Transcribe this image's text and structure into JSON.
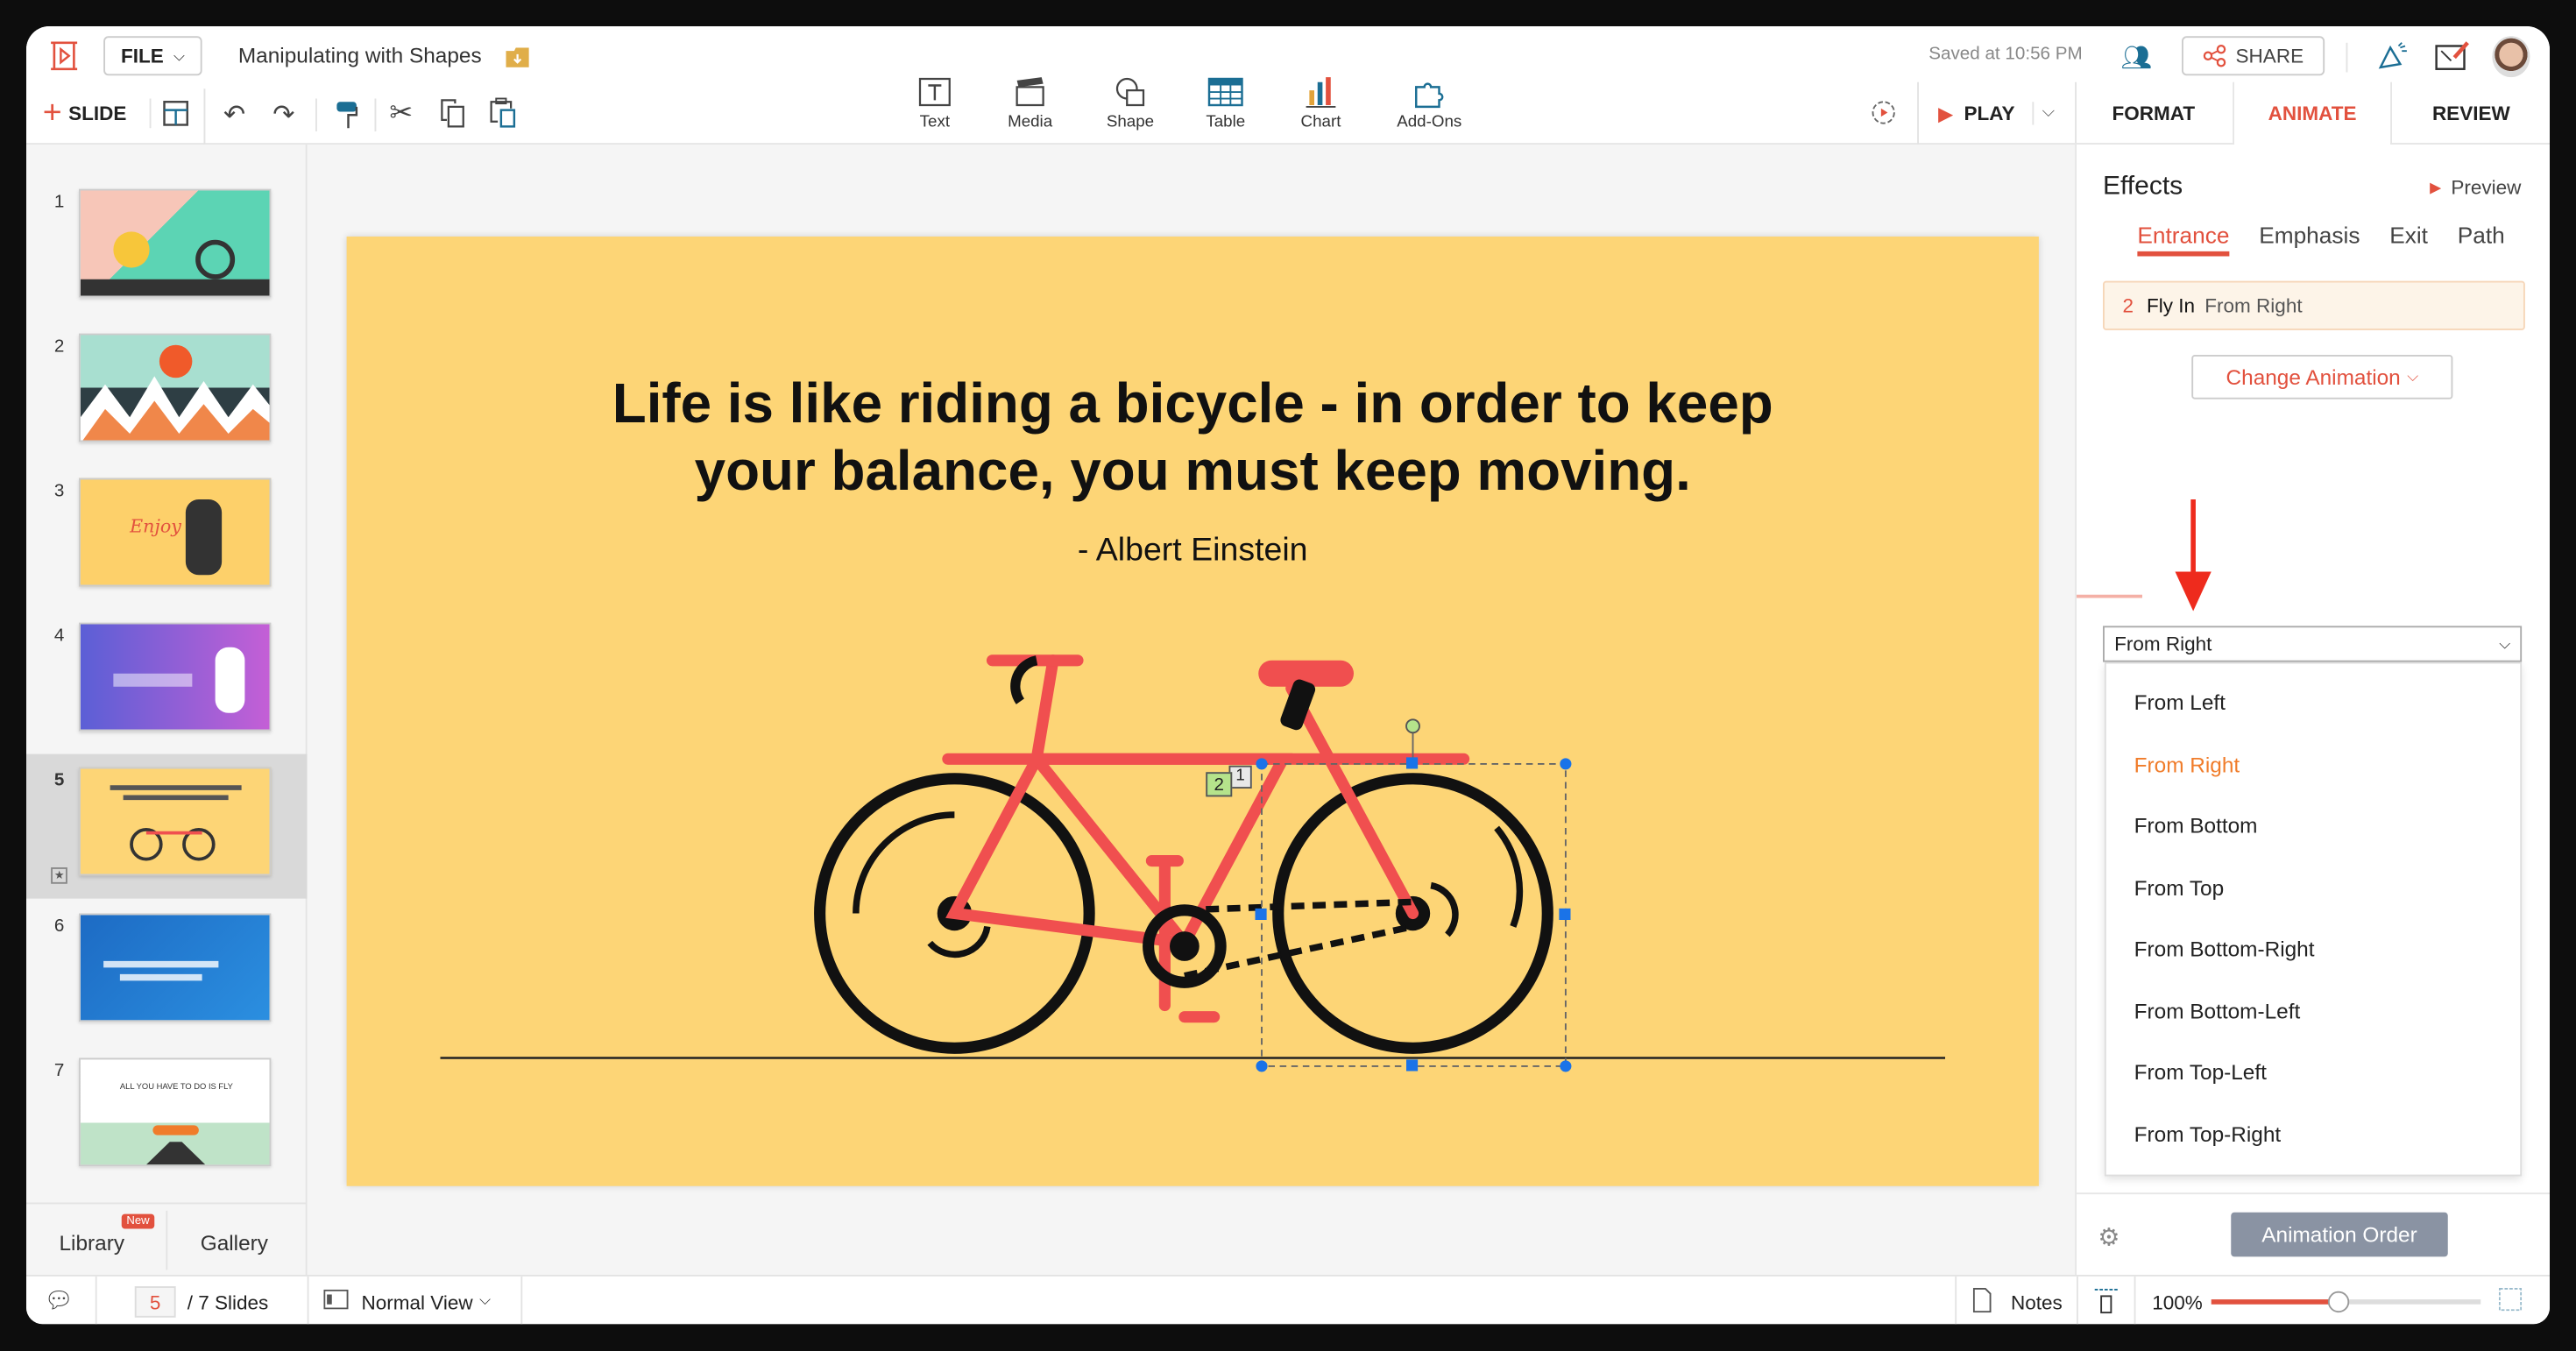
{
  "header": {
    "file_label": "FILE",
    "doc_title": "Manipulating with Shapes",
    "saved_status": "Saved at 10:56 PM",
    "share_label": "SHARE",
    "slide_label": "SLIDE",
    "play_label": "PLAY"
  },
  "insert_tools": [
    {
      "label": "Text",
      "icon": "text-box-icon"
    },
    {
      "label": "Media",
      "icon": "clapperboard-icon"
    },
    {
      "label": "Shape",
      "icon": "shape-icon"
    },
    {
      "label": "Table",
      "icon": "table-icon"
    },
    {
      "label": "Chart",
      "icon": "bar-chart-icon"
    },
    {
      "label": "Add-Ons",
      "icon": "puzzle-icon"
    }
  ],
  "panel_tabs": [
    {
      "label": "FORMAT",
      "active": false
    },
    {
      "label": "ANIMATE",
      "active": true
    },
    {
      "label": "REVIEW",
      "active": false
    }
  ],
  "slides": {
    "numbers": [
      "1",
      "2",
      "3",
      "4",
      "5",
      "6",
      "7"
    ],
    "selected": 5,
    "thumb3_text": "Enjoy",
    "thumb7_text": "ALL YOU HAVE TO DO IS FLY"
  },
  "left_footer": {
    "library": "Library",
    "new_badge": "New",
    "gallery": "Gallery"
  },
  "slide_content": {
    "quote_line1": "Life is like riding a bicycle - in order to keep",
    "quote_line2": "your balance, you must keep moving.",
    "author": "- Albert Einstein",
    "anim_tag_1": "1",
    "anim_tag_2": "2"
  },
  "effects": {
    "title": "Effects",
    "preview": "Preview",
    "tabs": [
      "Entrance",
      "Emphasis",
      "Exit",
      "Path"
    ],
    "active_tab": "Entrance",
    "applied": {
      "order": "2",
      "name": "Fly In",
      "direction": "From Right"
    },
    "change_animation": "Change Animation",
    "direction_select": "From Right",
    "direction_options": [
      "From Left",
      "From Right",
      "From Bottom",
      "From Top",
      "From Bottom-Right",
      "From Bottom-Left",
      "From Top-Left",
      "From Top-Right"
    ],
    "animation_order": "Animation Order"
  },
  "status": {
    "current_slide": "5",
    "total_slides": "/ 7 Slides",
    "view": "Normal View",
    "notes": "Notes",
    "zoom": "100%",
    "zoom_level": 0.47
  },
  "colors": {
    "accent": "#e2513e",
    "slide_bg": "#fdd576",
    "bike": "#f04f4f",
    "selected_option": "#f07c2a",
    "button_grey": "#8a93a3"
  }
}
